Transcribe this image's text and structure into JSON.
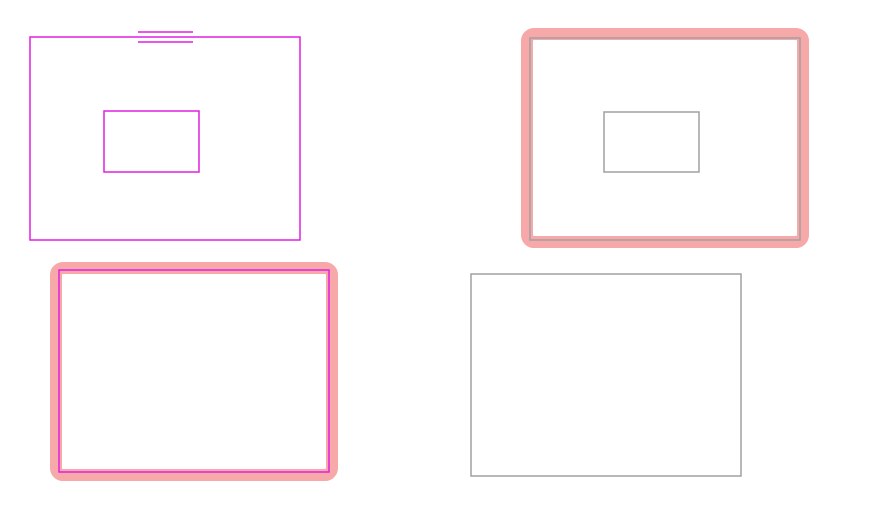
{
  "colors": {
    "background": "#ffffff",
    "magenta": "#e020e0",
    "gray": "#a0a0a0",
    "highlight": "#f7a8a8"
  },
  "shapes": {
    "rect_a": {
      "stroke": "magenta",
      "selected": false,
      "has_inner_rect": true,
      "has_top_marker": true
    },
    "rect_b": {
      "stroke": "gray",
      "selected": true,
      "has_inner_rect": true,
      "has_top_marker": false
    },
    "rect_c": {
      "stroke": "magenta",
      "selected": true,
      "has_inner_rect": false,
      "has_top_marker": false
    },
    "rect_d": {
      "stroke": "gray",
      "selected": false,
      "has_inner_rect": false,
      "has_top_marker": false
    }
  }
}
